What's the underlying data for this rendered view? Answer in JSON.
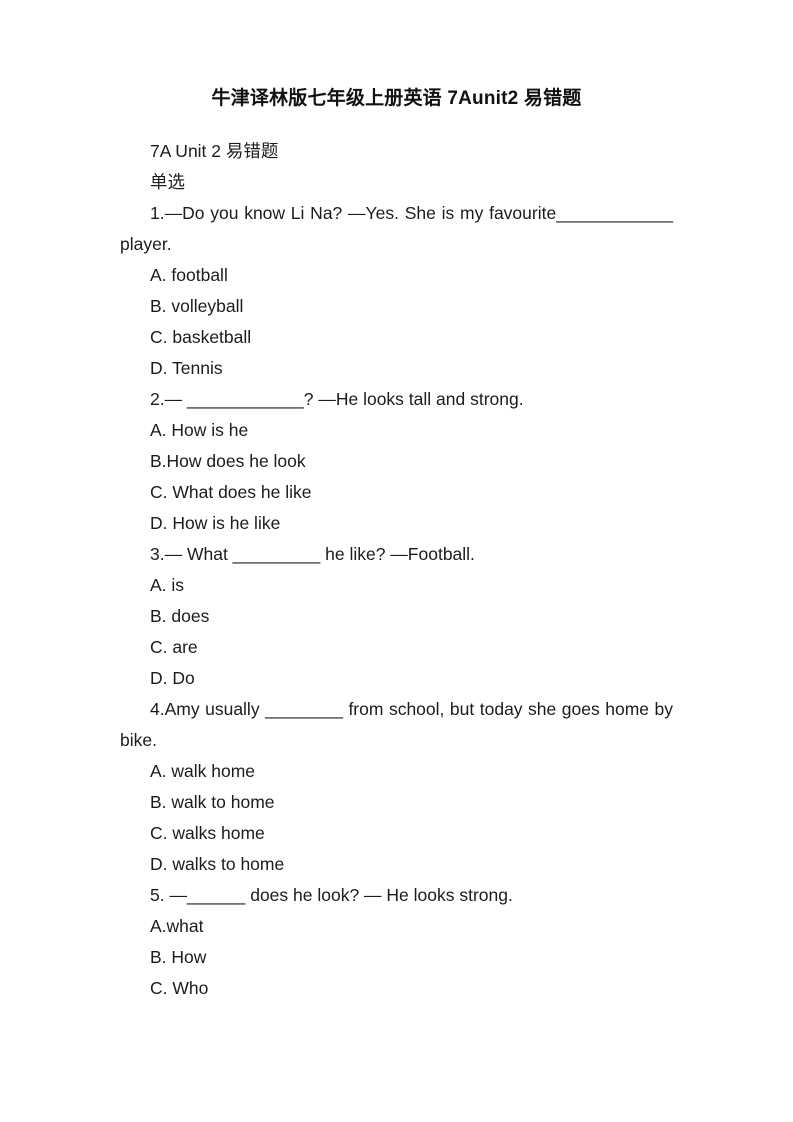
{
  "document": {
    "title": "牛津译林版七年级上册英语 7Aunit2 易错题",
    "heading": "7A Unit 2 易错题",
    "section_label": "单选",
    "lines": [
      "1.—Do you know Li Na? —Yes. She is my favourite____________ player.",
      "A. football",
      "B. volleyball",
      "C. basketball",
      "D. Tennis",
      "2.— ____________? —He looks tall and strong.",
      "A. How is he",
      "B.How does he look",
      "C. What does he like",
      "D. How is he like",
      "3.— What _________ he like? —Football.",
      "A. is",
      "B. does",
      "C. are",
      "D. Do",
      "4.Amy usually ________ from school, but today she goes home by bike.",
      "A. walk home",
      "B. walk to home",
      "C. walks home",
      "D. walks to home",
      "5. —______ does he look? — He looks strong.",
      "A.what",
      "B. How",
      "C. Who"
    ],
    "questions": [
      {
        "number": "1",
        "stem": "1.—Do you know Li Na? —Yes. She is my favourite____________ player.",
        "wraps": true,
        "options": [
          "A. football",
          "B. volleyball",
          "C. basketball",
          "D. Tennis"
        ]
      },
      {
        "number": "2",
        "stem": "2.— ____________? —He looks tall and strong.",
        "wraps": false,
        "options": [
          "A. How is he",
          "B.How does he look",
          "C. What does he like",
          "D. How is he like"
        ]
      },
      {
        "number": "3",
        "stem": "3.— What _________ he like? —Football.",
        "wraps": false,
        "options": [
          "A. is",
          "B. does",
          "C. are",
          "D. Do"
        ]
      },
      {
        "number": "4",
        "stem": "4.Amy usually ________ from school, but today she goes home by bike.",
        "wraps": true,
        "options": [
          "A. walk home",
          "B. walk to home",
          "C. walks home",
          "D. walks to home"
        ]
      },
      {
        "number": "5",
        "stem": "5. —______ does he look? — He looks strong.",
        "wraps": false,
        "options": [
          "A.what",
          "B. How",
          "C. Who"
        ]
      }
    ]
  },
  "style": {
    "text_color": "#1c1c1c",
    "title_color": "#111111",
    "page_background": "#ffffff"
  }
}
